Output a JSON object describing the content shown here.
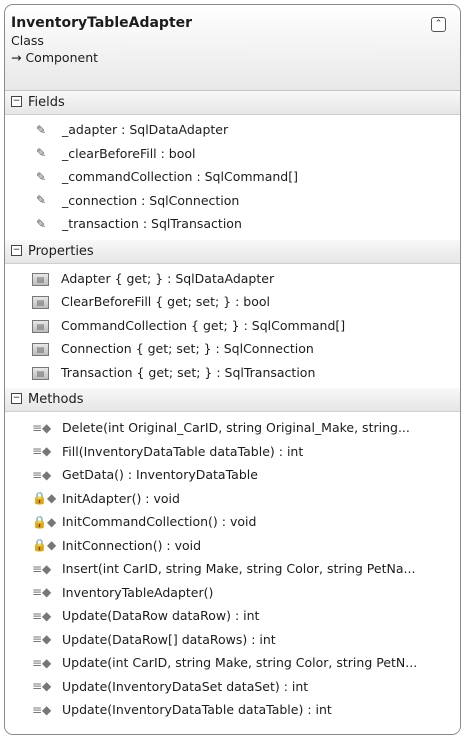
{
  "header": {
    "title": "InventoryTableAdapter",
    "kind": "Class",
    "base": "→ Component",
    "collapse_glyph": "ˆ"
  },
  "fields": {
    "label": "Fields",
    "items": [
      "_adapter : SqlDataAdapter",
      "_clearBeforeFill : bool",
      "_commandCollection : SqlCommand[]",
      "_connection : SqlConnection",
      "_transaction : SqlTransaction"
    ]
  },
  "properties": {
    "label": "Properties",
    "items": [
      "Adapter { get; } : SqlDataAdapter",
      "ClearBeforeFill { get; set; } : bool",
      "CommandCollection { get; } : SqlCommand[]",
      "Connection { get; set; } : SqlConnection",
      "Transaction { get; set; } : SqlTransaction"
    ]
  },
  "methods": {
    "label": "Methods",
    "items": [
      "Delete(int Original_CarID, string Original_Make, string...",
      "Fill(InventoryDataTable dataTable) : int",
      "GetData() : InventoryDataTable",
      "InitAdapter() : void",
      "InitCommandCollection() : void",
      "InitConnection() : void",
      "Insert(int CarID, string Make, string Color, string PetNa...",
      "InventoryTableAdapter()",
      "Update(DataRow dataRow) : int",
      "Update(DataRow[] dataRows) : int",
      "Update(int CarID, string Make, string Color, string PetN...",
      "Update(InventoryDataSet dataSet) : int",
      "Update(InventoryDataTable dataTable) : int"
    ]
  },
  "icons": {
    "field": "field-icon",
    "property": "property-icon",
    "method": "method-icon"
  }
}
